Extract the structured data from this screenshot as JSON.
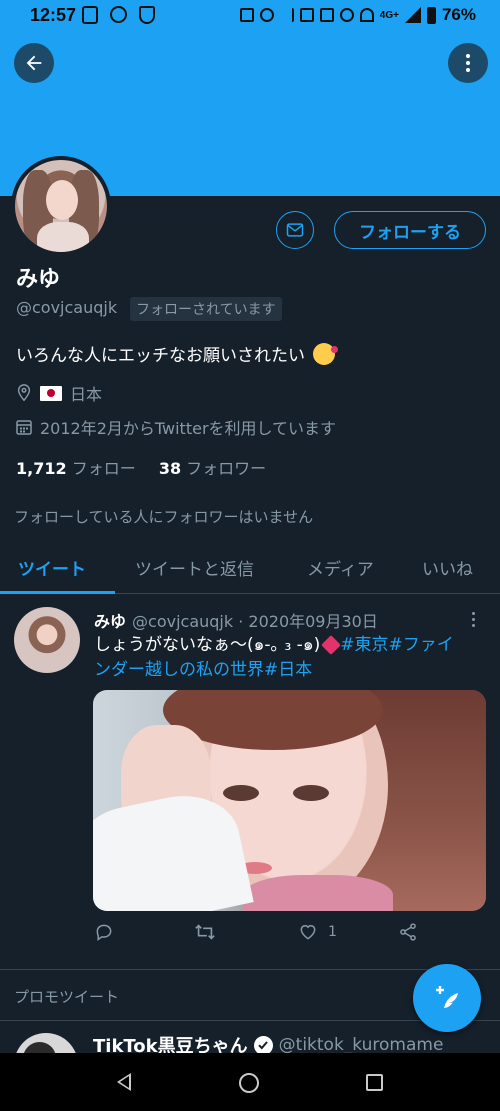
{
  "status_bar": {
    "time": "12:57",
    "network": "4G+",
    "battery": "76%"
  },
  "profile": {
    "display_name": "みゆ",
    "handle": "@covjcauqjk",
    "follows_you": "フォローされています",
    "bio": "いろんな人にエッチなお願いされたい",
    "location": "日本",
    "joined": "2012年2月からTwitterを利用しています",
    "following_count": "1,712",
    "following_label": "フォロー",
    "followers_count": "38",
    "followers_label": "フォロワー",
    "mutual_note": "フォローしている人にフォロワーはいません",
    "follow_button": "フォローする",
    "icons": {
      "back": "arrow-left-icon",
      "more": "more-vertical-icon",
      "message": "envelope-icon",
      "location": "location-pin-icon",
      "calendar": "calendar-icon"
    }
  },
  "tabs": [
    {
      "label": "ツイート",
      "active": true
    },
    {
      "label": "ツイートと返信",
      "active": false
    },
    {
      "label": "メディア",
      "active": false
    },
    {
      "label": "いいね",
      "active": false
    }
  ],
  "tweet": {
    "author": "みゆ",
    "handle": "@covjcauqjk",
    "separator": "·",
    "date": "2020年09月30日",
    "text_line1": "しょうがないなぁ〜(๑-｡ ₃ -๑)",
    "text_tags_a": "#東京#ファイ",
    "text_tags_b": "ンダー越しの私の世界#日本",
    "like_count": "1"
  },
  "promo": {
    "label": "プロモツイート",
    "name": "TikTok黒豆ちゃん",
    "handle": "@tiktok_kuromame"
  },
  "colors": {
    "accent": "#1da1f2",
    "background": "#15202b",
    "secondary_text": "#8899a6"
  }
}
